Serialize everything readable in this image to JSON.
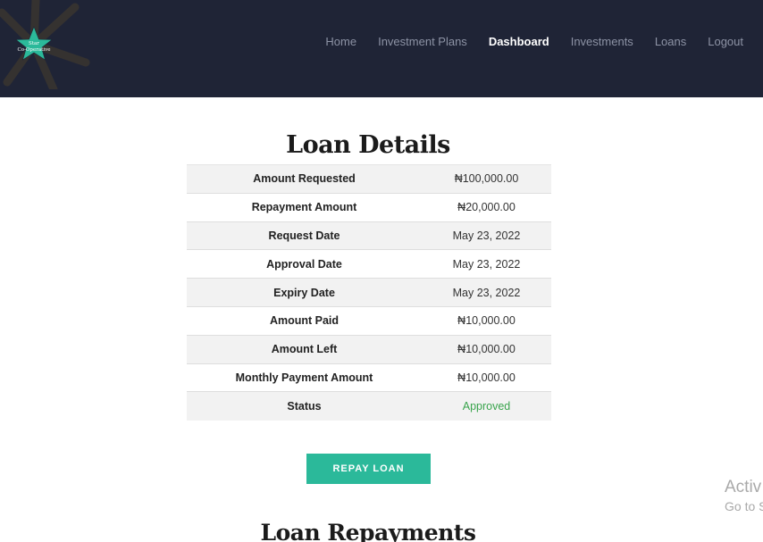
{
  "brand": {
    "logo_text_line1": "Star",
    "logo_text_line2": "Co-Operative"
  },
  "nav": {
    "items": [
      {
        "label": "Home",
        "active": false
      },
      {
        "label": "Investment Plans",
        "active": false
      },
      {
        "label": "Dashboard",
        "active": true
      },
      {
        "label": "Investments",
        "active": false
      },
      {
        "label": "Loans",
        "active": false
      },
      {
        "label": "Logout",
        "active": false
      }
    ]
  },
  "loan_details": {
    "title": "Loan Details",
    "rows": [
      {
        "label": "Amount Requested",
        "value": "₦100,000.00"
      },
      {
        "label": "Repayment Amount",
        "value": "₦20,000.00"
      },
      {
        "label": "Request Date",
        "value": "May 23, 2022"
      },
      {
        "label": "Approval Date",
        "value": "May 23, 2022"
      },
      {
        "label": "Expiry Date",
        "value": "May 23, 2022"
      },
      {
        "label": "Amount Paid",
        "value": "₦10,000.00"
      },
      {
        "label": "Amount Left",
        "value": "₦10,000.00"
      },
      {
        "label": "Monthly Payment Amount",
        "value": "₦10,000.00"
      },
      {
        "label": "Status",
        "value": "Approved"
      }
    ]
  },
  "repay_button": {
    "label": "REPAY LOAN"
  },
  "repayments": {
    "title": "Loan Repayments"
  },
  "watermark": {
    "line1": "Activ",
    "line2": "Go to S"
  },
  "colors": {
    "navbar_bg": "#1f2436",
    "accent": "#2bb99a",
    "status_approved": "#3aa44d"
  }
}
